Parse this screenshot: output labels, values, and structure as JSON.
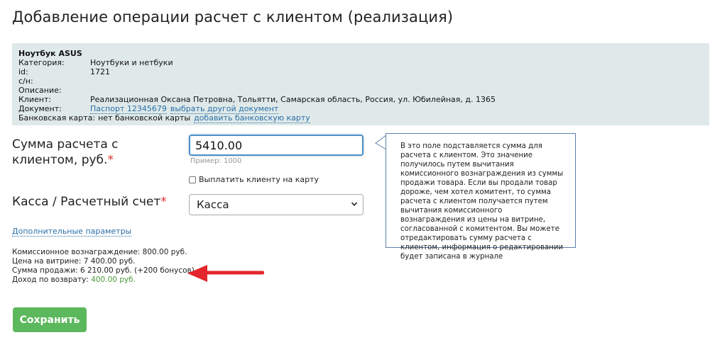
{
  "page": {
    "title": "Добавление операции расчет с клиентом (реализация)"
  },
  "info": {
    "product_name": "Ноутбук ASUS",
    "rows": [
      {
        "key": "Категория:",
        "value": "Ноутбуки и нетбуки"
      },
      {
        "key": "id:",
        "value": "1721"
      },
      {
        "key": "с/н:",
        "value": ""
      },
      {
        "key": "Описание:",
        "value": ""
      },
      {
        "key": "Клиент:",
        "value": "Реализационная Оксана Петровна, Тольятти, Самарская область, Россия, ул. Юбилейная, д. 1365"
      }
    ],
    "document_key": "Документ:",
    "document_link": "Паспорт 12345679",
    "document_change_link": "выбрать другой документ",
    "bank_key": "Банковская карта:",
    "bank_value": "нет банковской карты",
    "bank_add_link": "добавить банковскую карту"
  },
  "form": {
    "sum_label": "Сумма расчета с клиентом, руб.",
    "required_mark": "*",
    "sum_value": "5410.00",
    "sum_hint": "Пример: 1000",
    "pay_to_card_label": "Выплатить клиенту на карту",
    "cash_label": "Касса / Расчетный счет",
    "cash_selected": "Касса",
    "extra_params_link": "Дополнительные параметры"
  },
  "tooltip": {
    "text": "В это поле подставляется сумма для расчета с клиентом. Это значение получилось путем вычитания комиссионного вознаграждения из суммы продажи товара. Если вы продали товар дороже, чем хотел комитент, то сумма расчета с клиентом получается путем вычитания комиссионного вознаграждения из цены на витрине, согласованной с комитентом. Вы можете отредактировать сумму расчета с клиентом, информация о редактировании будет записана в журнале"
  },
  "summary": {
    "commission": "Комиссионное вознаграждение: 800.00 руб.",
    "showcase_price": "Цена на витрине: 7 400.00 руб.",
    "sale_sum": "Сумма продажи: 6 210.00 руб. (+200 бонусов)",
    "refund_income_label": "Доход по возврату: ",
    "refund_income_value": "400.00 руб."
  },
  "actions": {
    "save_label": "Сохранить"
  },
  "colors": {
    "accent_red": "#e3262b",
    "save_green": "#5cb85c",
    "link_blue": "#2a6fa8",
    "panel_bg": "#dfe9e9"
  },
  "icons": [
    "chevron-down-icon",
    "red-arrow-icon",
    "tooltip-arrow-icon"
  ]
}
